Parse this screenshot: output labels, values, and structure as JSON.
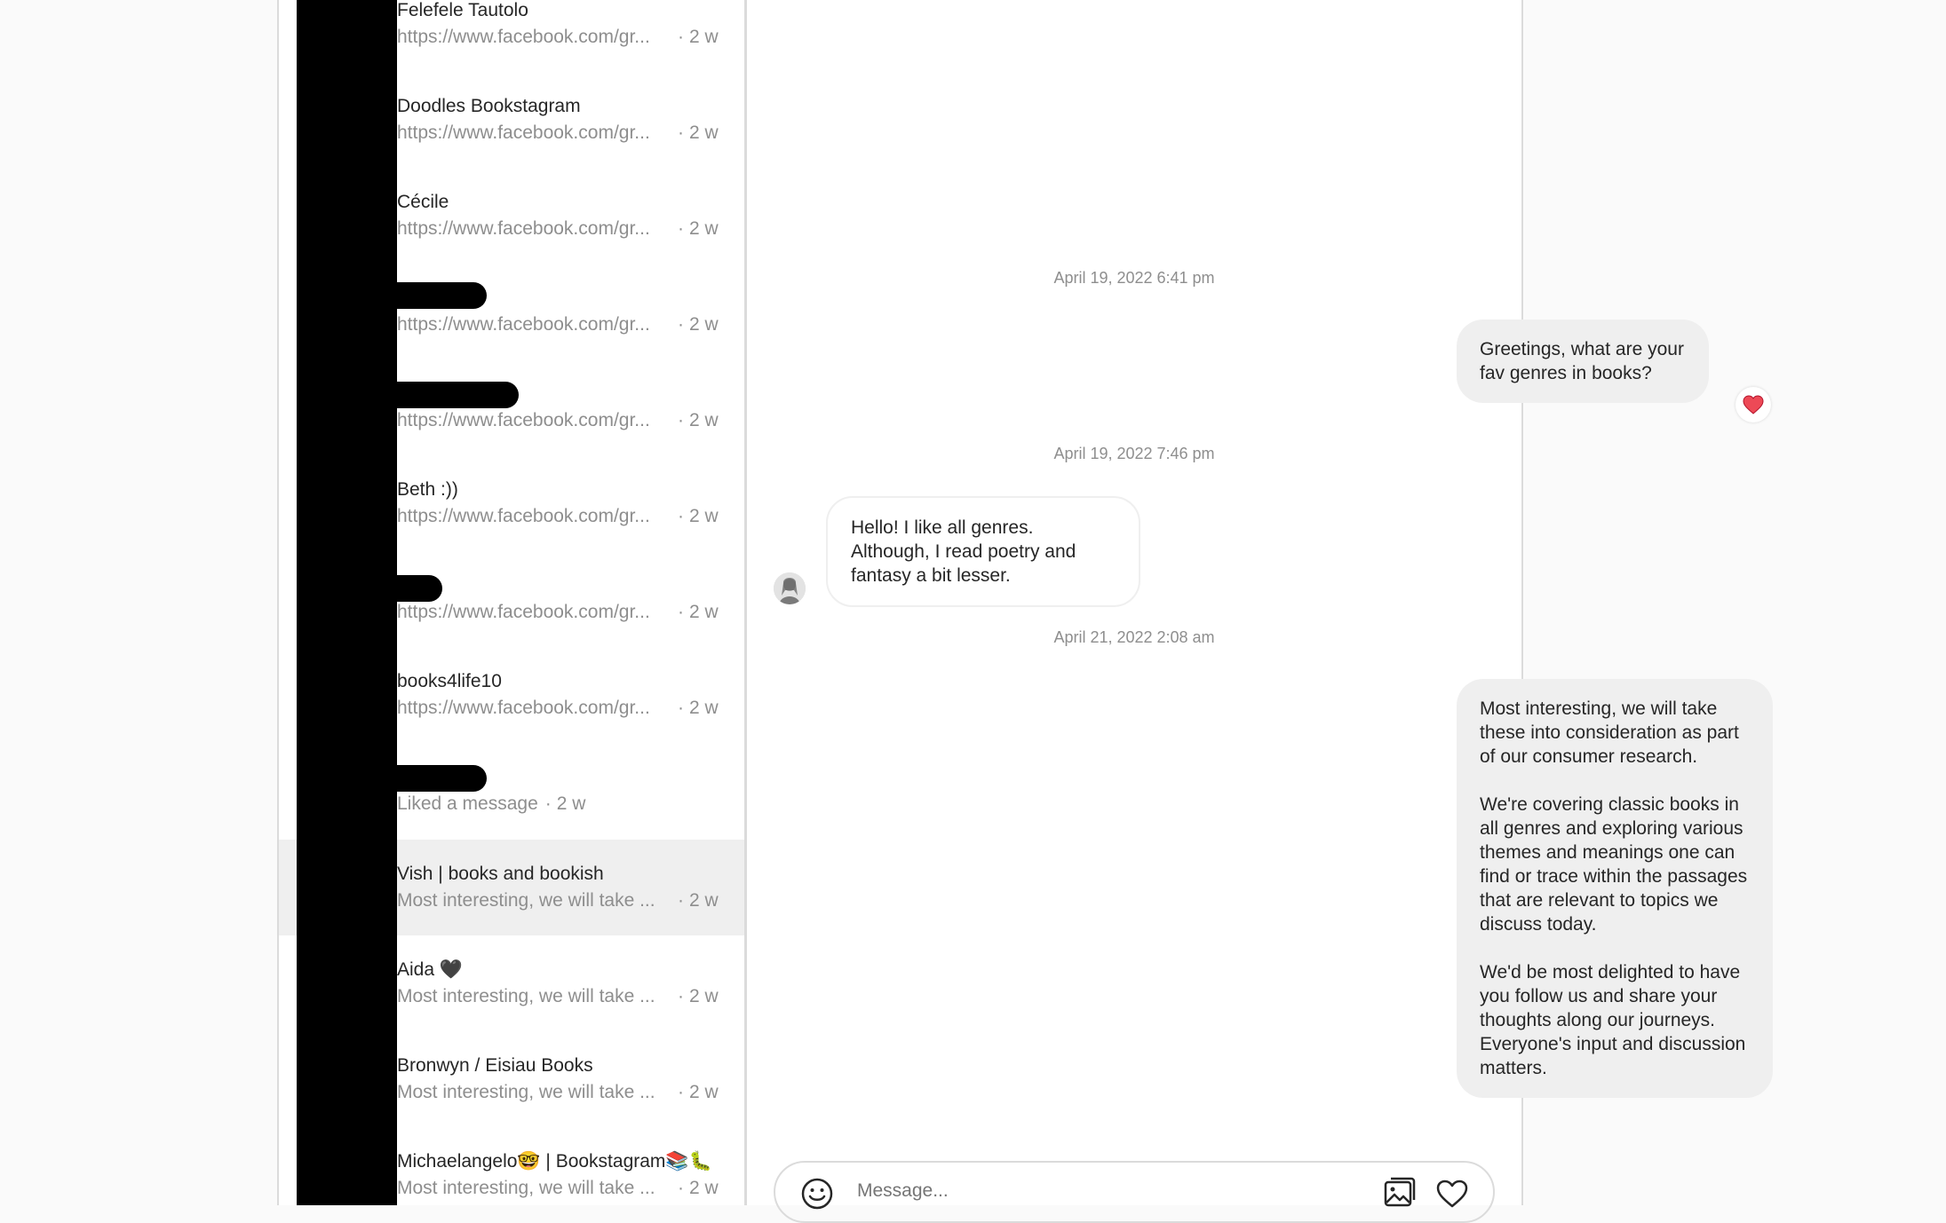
{
  "inbox": {
    "threads": [
      {
        "name": "Felefele Tautolo",
        "preview": "https://www.facebook.com/gr...",
        "time": "2 w"
      },
      {
        "name": "Doodles Bookstagram",
        "preview": "https://www.facebook.com/gr...",
        "time": "2 w"
      },
      {
        "name": "Cécile",
        "preview": "https://www.facebook.com/gr...",
        "time": "2 w"
      },
      {
        "name": "",
        "preview": "https://www.facebook.com/gr...",
        "time": "2 w"
      },
      {
        "name": "",
        "preview": "https://www.facebook.com/gr...",
        "time": "2 w"
      },
      {
        "name": "Beth :))",
        "preview": "https://www.facebook.com/gr...",
        "time": "2 w"
      },
      {
        "name": "",
        "preview": "https://www.facebook.com/gr...",
        "time": "2 w"
      },
      {
        "name": "books4life10",
        "preview": "https://www.facebook.com/gr...",
        "time": "2 w"
      },
      {
        "name": "",
        "preview": "Liked a message",
        "time": "2 w"
      },
      {
        "name": "Vish | books and bookish",
        "preview": "Most interesting, we will take ...",
        "time": "2 w"
      },
      {
        "name": "Aida 🖤",
        "preview": "Most interesting, we will take ...",
        "time": "2 w"
      },
      {
        "name": "Bronwyn / Eisiau Books",
        "preview": "Most interesting, we will take ...",
        "time": "2 w"
      },
      {
        "name": "Michaelangelo🤓 | Bookstagram📚🐛",
        "preview": "Most interesting, we will take ...",
        "time": "2 w"
      }
    ]
  },
  "chat": {
    "timestamps": [
      "April 19, 2022 6:41 pm",
      "April 19, 2022 7:46 pm",
      "April 21, 2022 2:08 am"
    ],
    "messages": [
      {
        "text": "Greetings, what are your fav genres in books?"
      },
      {
        "text": "Hello! I like all genres. Although, I read poetry and fantasy a bit lesser."
      },
      {
        "text": "Most interesting, we will take these into consideration as part of our consumer research.\n\nWe're covering classic books in all genres and exploring various themes and meanings one can find or trace within the passages that are relevant to topics we discuss today.\n\nWe'd be most delighted to have you follow us and share your thoughts along our journeys. Everyone's input and discussion matters."
      }
    ],
    "reaction": "❤️",
    "composer": {
      "placeholder": "Message..."
    }
  },
  "colors": {
    "bubble_out": "#efefef",
    "muted_text": "#8e8e8e",
    "selected_row": "#efefef",
    "heart": "#ed4956"
  },
  "icons": [
    "emoji-icon",
    "image-icon",
    "heart-icon",
    "heart-reaction-icon"
  ]
}
